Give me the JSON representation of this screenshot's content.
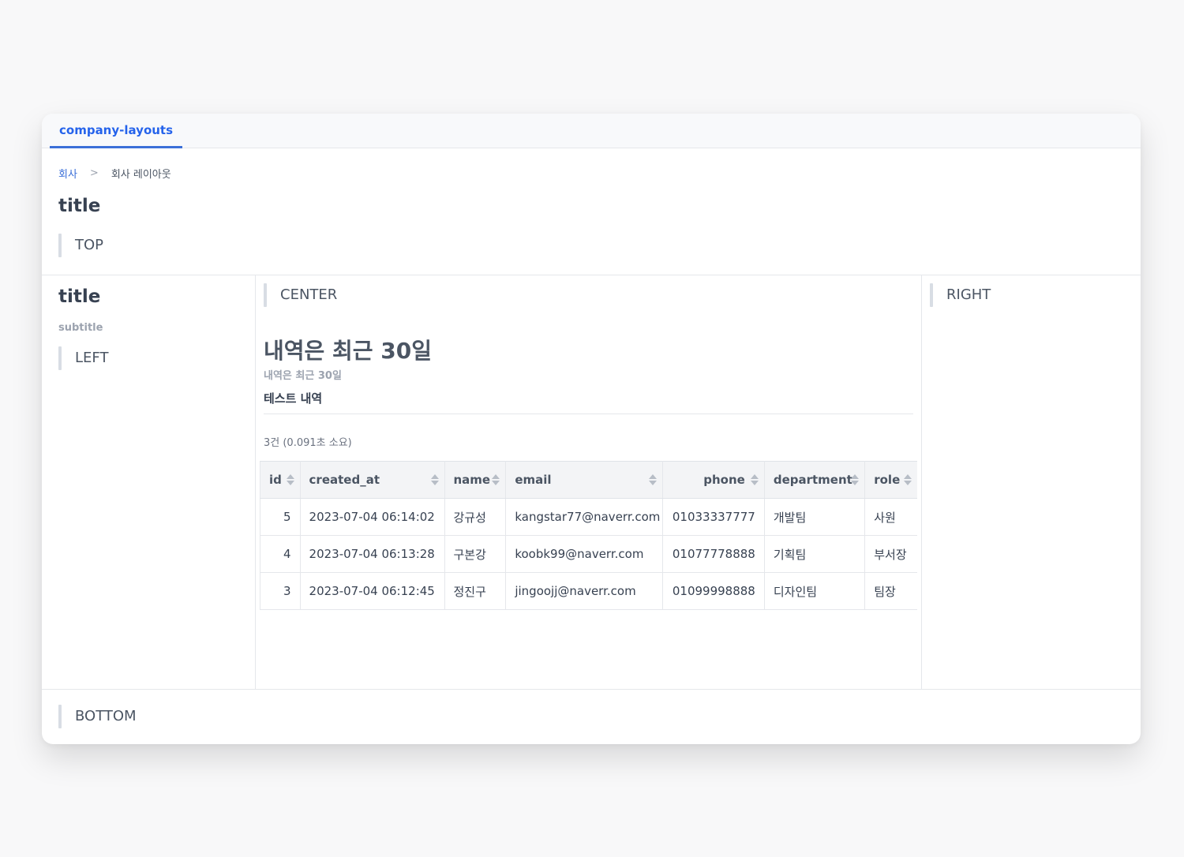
{
  "tab": {
    "label": "company-layouts"
  },
  "breadcrumb": {
    "root": "회사",
    "separator": ">",
    "current": "회사 레이아웃"
  },
  "top": {
    "title": "title",
    "marker": "TOP"
  },
  "left": {
    "title": "title",
    "subtitle": "subtitle",
    "marker": "LEFT"
  },
  "center": {
    "marker": "CENTER",
    "heading": "내역은 최근 30일",
    "subheading": "내역은 최근 30일",
    "section_label": "테스트 내역",
    "result_meta": "3건 (0.091초 소요)"
  },
  "right": {
    "marker": "RIGHT"
  },
  "bottom": {
    "marker": "BOTTOM"
  },
  "table": {
    "columns": [
      "id",
      "created_at",
      "name",
      "email",
      "phone",
      "department",
      "role"
    ],
    "rows": [
      [
        "5",
        "2023-07-04 06:14:02",
        "강규성",
        "kangstar77@naverr.com",
        "01033337777",
        "개발팀",
        "사원"
      ],
      [
        "4",
        "2023-07-04 06:13:28",
        "구본강",
        "koobk99@naverr.com",
        "01077778888",
        "기획팀",
        "부서장"
      ],
      [
        "3",
        "2023-07-04 06:12:45",
        "정진구",
        "jingoojj@naverr.com",
        "01099998888",
        "디자인팀",
        "팀장"
      ]
    ]
  },
  "colors": {
    "accent": "#2563eb",
    "border": "#e5e7eb",
    "header_bg": "#f3f4f6",
    "marker_bar": "#d8dde4"
  }
}
